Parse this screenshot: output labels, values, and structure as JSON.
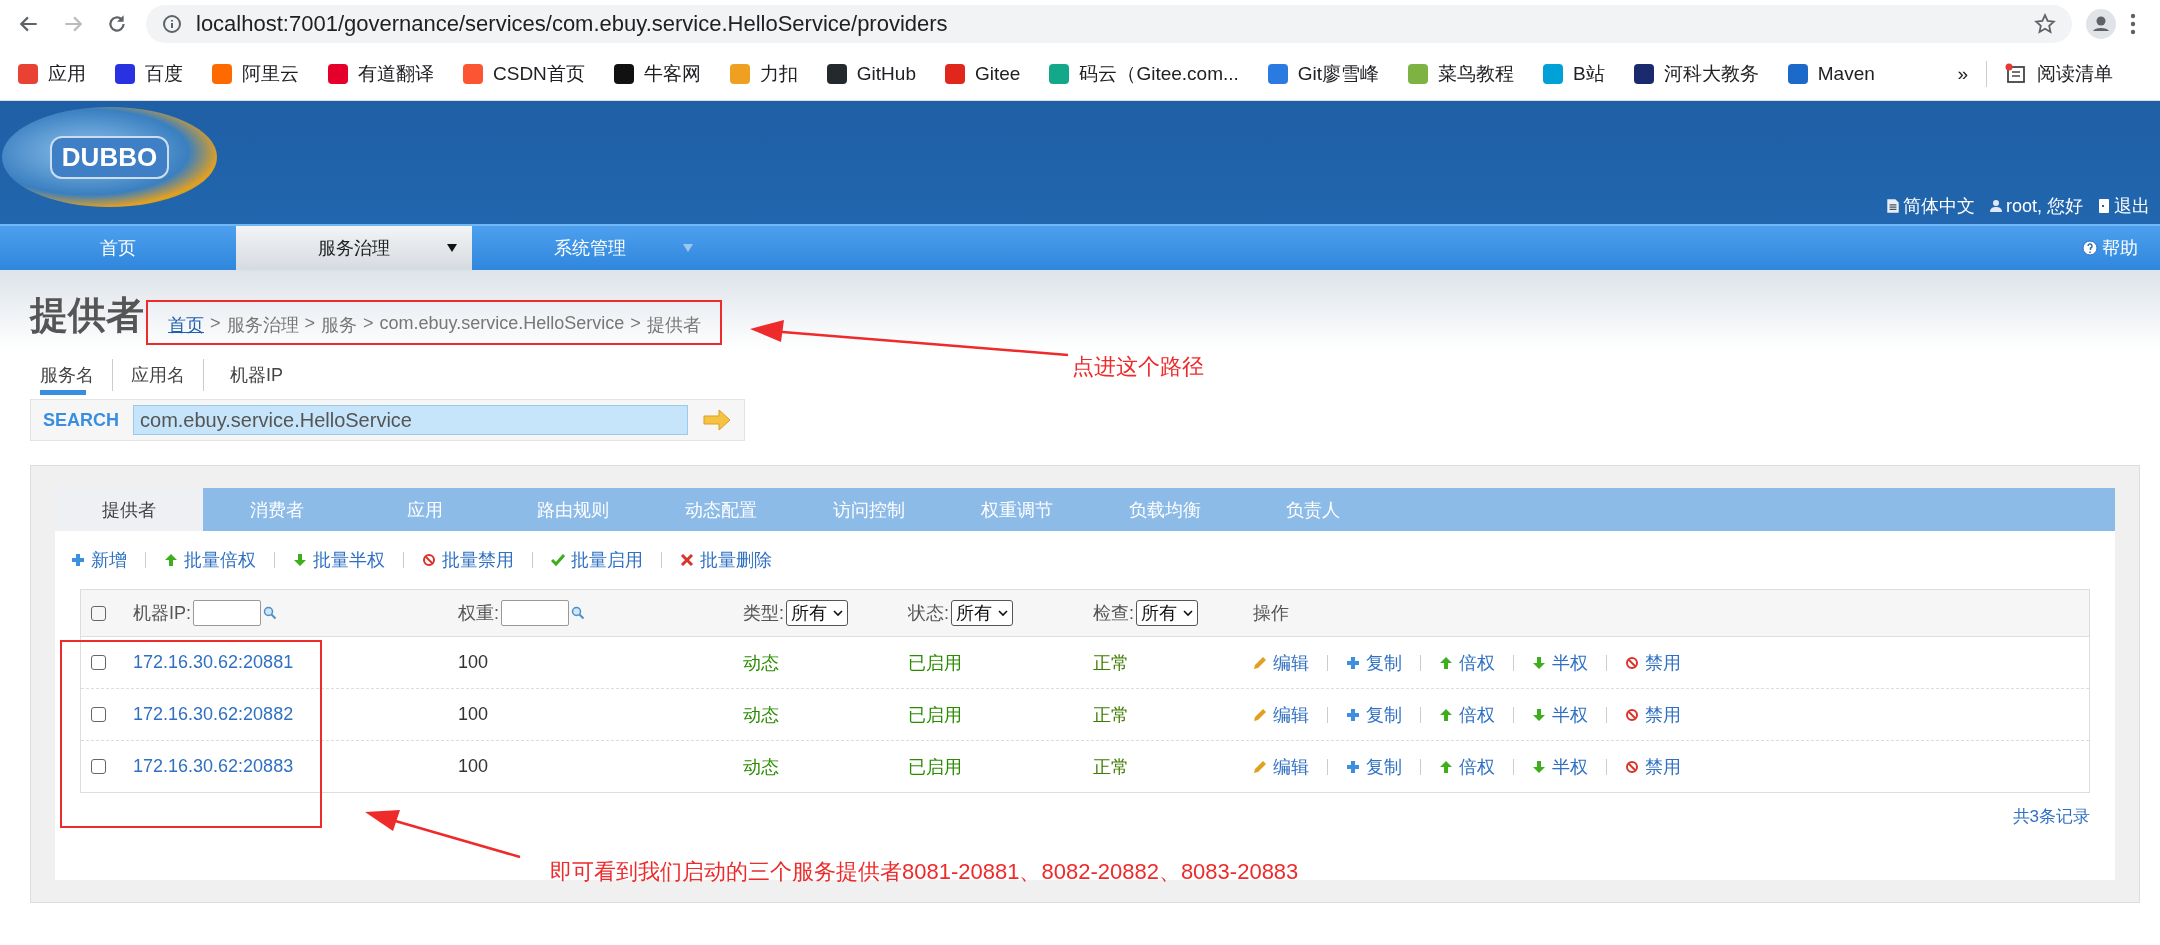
{
  "browser": {
    "url": "localhost:7001/governance/services/com.ebuy.service.HelloService/providers",
    "bookmarks": [
      {
        "label": "应用",
        "color": "#e94235"
      },
      {
        "label": "百度",
        "color": "#2932e1"
      },
      {
        "label": "阿里云",
        "color": "#ff6a00"
      },
      {
        "label": "有道翻译",
        "color": "#e4002b"
      },
      {
        "label": "CSDN首页",
        "color": "#fc5531"
      },
      {
        "label": "牛客网",
        "color": "#111111"
      },
      {
        "label": "力扣",
        "color": "#f0a020"
      },
      {
        "label": "GitHub",
        "color": "#24292e"
      },
      {
        "label": "Gitee",
        "color": "#e1261c"
      },
      {
        "label": "码云（Gitee.com...",
        "color": "#14a88a"
      },
      {
        "label": "Git廖雪峰",
        "color": "#2a7ae2"
      },
      {
        "label": "菜鸟教程",
        "color": "#7cb342"
      },
      {
        "label": "B站",
        "color": "#00a1d6"
      },
      {
        "label": "河科大教务",
        "color": "#1a2a6c"
      },
      {
        "label": "Maven",
        "color": "#1b6ac9"
      }
    ],
    "overflow": "»",
    "reading_list": "阅读清单"
  },
  "header": {
    "logo": "DUBBO",
    "links": [
      {
        "label": "简体中文",
        "kind": "doc"
      },
      {
        "label": "root, 您好",
        "kind": "user"
      },
      {
        "label": "退出",
        "kind": "exit"
      }
    ]
  },
  "nav": {
    "items": [
      {
        "label": "首页",
        "selected": false,
        "dropdown": false
      },
      {
        "label": "服务治理",
        "selected": true,
        "dropdown": true
      },
      {
        "label": "系统管理",
        "selected": false,
        "dropdown": true
      }
    ],
    "help": "帮助"
  },
  "page": {
    "title": "提供者",
    "breadcrumb": [
      {
        "label": "首页",
        "link": true
      },
      {
        "label": "服务治理",
        "link": false
      },
      {
        "label": "服务",
        "link": false
      },
      {
        "label": "com.ebuy.service.HelloService",
        "link": false
      },
      {
        "label": "提供者",
        "link": false
      }
    ],
    "separator": ">"
  },
  "search_tabs": [
    {
      "label": "服务名",
      "selected": true
    },
    {
      "label": "应用名",
      "selected": false
    },
    {
      "label": "机器IP",
      "selected": false
    }
  ],
  "search": {
    "label": "SEARCH",
    "value": "com.ebuy.service.HelloService"
  },
  "tabs": [
    {
      "label": "提供者",
      "selected": true
    },
    {
      "label": "消费者",
      "selected": false
    },
    {
      "label": "应用",
      "selected": false
    },
    {
      "label": "路由规则",
      "selected": false
    },
    {
      "label": "动态配置",
      "selected": false
    },
    {
      "label": "访问控制",
      "selected": false
    },
    {
      "label": "权重调节",
      "selected": false
    },
    {
      "label": "负载均衡",
      "selected": false
    },
    {
      "label": "负责人",
      "selected": false
    }
  ],
  "actions": [
    {
      "label": "新增",
      "kind": "add"
    },
    {
      "label": "批量倍权",
      "kind": "up"
    },
    {
      "label": "批量半权",
      "kind": "down"
    },
    {
      "label": "批量禁用",
      "kind": "ban"
    },
    {
      "label": "批量启用",
      "kind": "check"
    },
    {
      "label": "批量删除",
      "kind": "delete"
    }
  ],
  "table": {
    "select_all": {
      "checked": false
    },
    "filters": [
      {
        "label": "机器IP:",
        "kind": "input"
      },
      {
        "label": "权重:",
        "kind": "input"
      },
      {
        "label": "类型:",
        "kind": "select",
        "value": "所有"
      },
      {
        "label": "状态:",
        "kind": "select",
        "value": "所有"
      },
      {
        "label": "检查:",
        "kind": "select",
        "value": "所有"
      },
      {
        "label": "操作",
        "kind": "text"
      }
    ],
    "rows": [
      {
        "checked": false,
        "address": "172.16.30.62:20881",
        "weight": "100",
        "type": "动态",
        "status": "已启用",
        "check": "正常",
        "actions": [
          {
            "label": "编辑",
            "kind": "edit"
          },
          {
            "label": "复制",
            "kind": "add"
          },
          {
            "label": "倍权",
            "kind": "up"
          },
          {
            "label": "半权",
            "kind": "down"
          },
          {
            "label": "禁用",
            "kind": "ban"
          }
        ]
      },
      {
        "checked": false,
        "address": "172.16.30.62:20882",
        "weight": "100",
        "type": "动态",
        "status": "已启用",
        "check": "正常",
        "actions": [
          {
            "label": "编辑",
            "kind": "edit"
          },
          {
            "label": "复制",
            "kind": "add"
          },
          {
            "label": "倍权",
            "kind": "up"
          },
          {
            "label": "半权",
            "kind": "down"
          },
          {
            "label": "禁用",
            "kind": "ban"
          }
        ]
      },
      {
        "checked": false,
        "address": "172.16.30.62:20883",
        "weight": "100",
        "type": "动态",
        "status": "已启用",
        "check": "正常",
        "actions": [
          {
            "label": "编辑",
            "kind": "edit"
          },
          {
            "label": "复制",
            "kind": "add"
          },
          {
            "label": "倍权",
            "kind": "up"
          },
          {
            "label": "半权",
            "kind": "down"
          },
          {
            "label": "禁用",
            "kind": "ban"
          }
        ]
      }
    ],
    "total": "共3条记录"
  },
  "annotations": [
    {
      "text": "点进这个路径"
    },
    {
      "text": "即可看到我们启动的三个服务提供者8081-20881、8082-20882、8083-20883"
    }
  ]
}
